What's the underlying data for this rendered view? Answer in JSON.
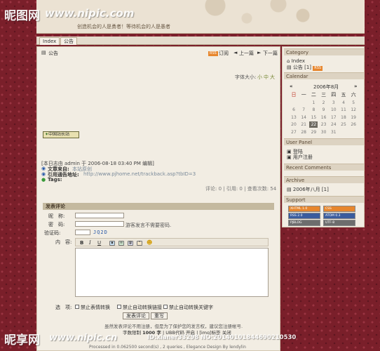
{
  "watermark": {
    "top_logo": "昵图网",
    "top_url": "www.nipic.com",
    "bottom_logo": "昵享网",
    "bottom_url": "www.nipic.cn",
    "bottom_id": "ID:xianer33298 NO:20140101844690210530"
  },
  "header": {
    "slogan": "创造机会的人是勇者！等待机会的人是愚者"
  },
  "nav": {
    "tabs": [
      "Index",
      "公告"
    ]
  },
  "post": {
    "category": "公告",
    "toolbar": [
      "订阅",
      "上一篇",
      "下一篇"
    ],
    "font_size_label": "字体大小:",
    "font_sizes": [
      "小",
      "中",
      "大"
    ],
    "badge_text": "中国站长站",
    "edit_note": "[本日志由 admin 于 2006-08-18 03:40 PM 编辑]",
    "source_label": "文章来自:",
    "source_value": "本站原创",
    "trackback_label": "引用通告地址:",
    "trackback_value": "http://www.pjhome.net/trackback.asp?tbID=3",
    "tags_label": "Tags:",
    "stats": "评论: 0 | 引用: 0 | 查看次数: 54"
  },
  "comment_form": {
    "title": "发表评论",
    "nickname_label": "昵　称:",
    "password_label": "密　码:",
    "password_hint": "游客发言不需要密码.",
    "captcha_label": "验证码:",
    "captcha_value": "JQ2D",
    "content_label": "内　容:",
    "options_label": "选　项:",
    "options": [
      "禁止表情转换",
      "禁止自动转换链接",
      "禁止自动转换关键字"
    ],
    "submit_label": "发表评论",
    "reset_label": "重写",
    "note": "虽然发表评论不用注册，但是为了保护您的发言权，建议您注册帐号.",
    "limit_prefix": "字数限制",
    "limit_value": "1000 字",
    "limit_suffix": "| UBB代码 开启 | [img]标签 关闭",
    "footer": "Processed in 0.062500 second(s) , 2 queries , Elegance Design By lendylin"
  },
  "sidebar": {
    "category_title": "Category",
    "category_items": [
      {
        "label": "Index"
      },
      {
        "label": "公告 [1]",
        "badge": "RSS"
      }
    ],
    "calendar_title": "Calendar",
    "calendar": {
      "month": "2006年8月",
      "prev": "«",
      "next": "»",
      "weekdays": [
        "日",
        "一",
        "二",
        "三",
        "四",
        "五",
        "六"
      ],
      "weeks": [
        [
          "",
          "",
          "1",
          "2",
          "3",
          "4",
          "5"
        ],
        [
          "6",
          "7",
          "8",
          "9",
          "10",
          "11",
          "12"
        ],
        [
          "13",
          "14",
          "15",
          "16",
          "17",
          "18",
          "19"
        ],
        [
          "20",
          "21",
          "22",
          "23",
          "24",
          "25",
          "26"
        ],
        [
          "27",
          "28",
          "29",
          "30",
          "31",
          "",
          ""
        ]
      ],
      "today": "22"
    },
    "user_panel_title": "User Panel",
    "user_panel_items": [
      "登陆",
      "用户注册"
    ],
    "recent_comments_title": "Recent Comments",
    "archive_title": "Archive",
    "archive_items": [
      "2006年八月 [1]"
    ],
    "support_title": "Support",
    "support_badges": [
      "XHTML 1.0",
      "CSS",
      "RSS 2.0",
      "ATOM 0.3",
      "PJBLOG",
      "UTF-8"
    ],
    "colors": {
      "badge_orange": "#e7862d",
      "badge_blue": "#3a5c9e",
      "badge_gray": "#6d6d6d"
    }
  }
}
